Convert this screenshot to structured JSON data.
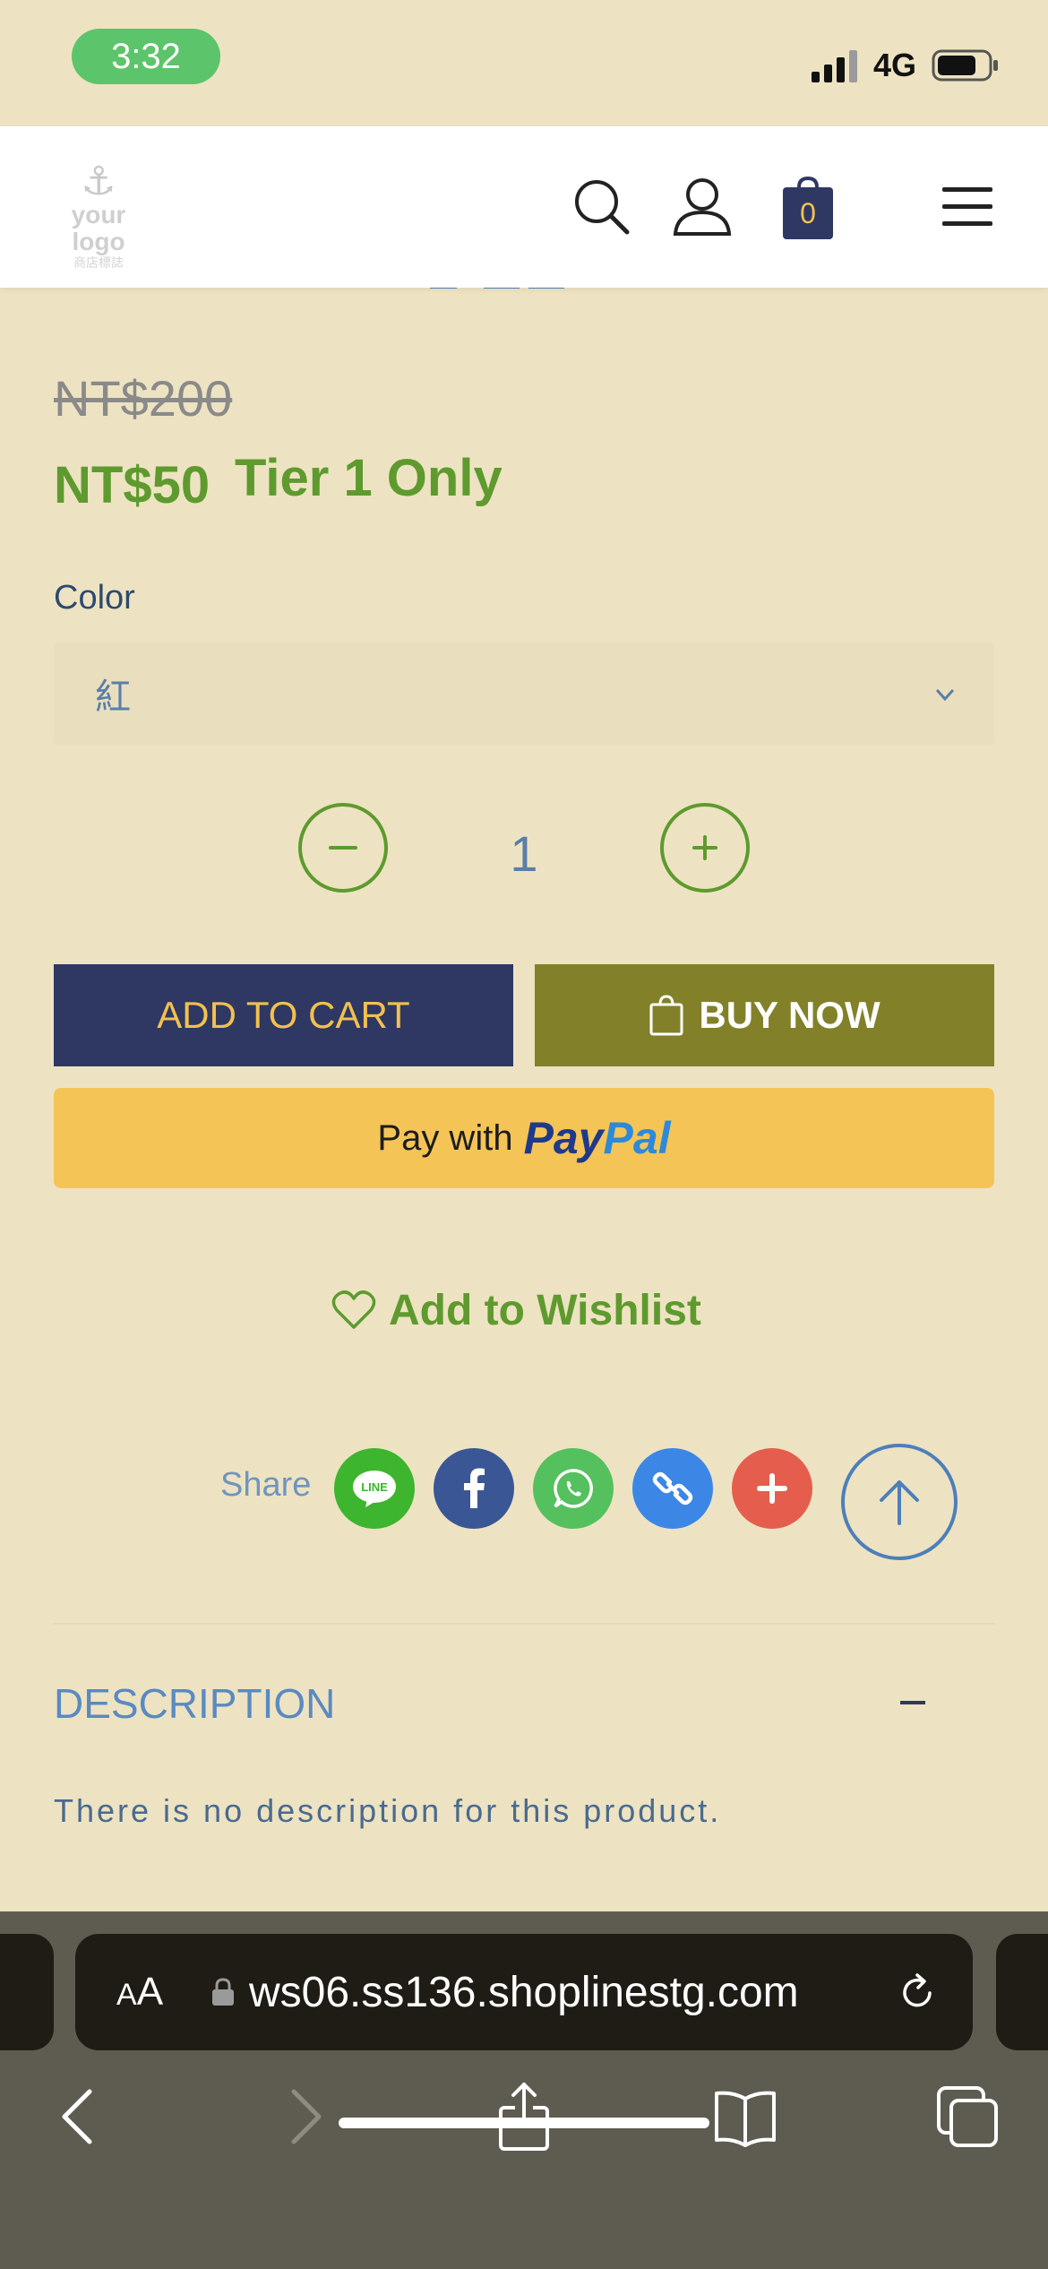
{
  "status_bar": {
    "time": "3:32",
    "network": "4G"
  },
  "header": {
    "logo": {
      "line1": "your logo",
      "line2": "商店標誌"
    },
    "cart_count": "0"
  },
  "product": {
    "original_price": "NT$200",
    "sale_price": "NT$50",
    "tier_label": "Tier 1 Only",
    "color_label": "Color",
    "color_value": "紅",
    "quantity": "1",
    "add_to_cart": "ADD TO CART",
    "buy_now": "BUY NOW",
    "paypal_prefix": "Pay with",
    "paypal_brand_pay": "Pay",
    "paypal_brand_pal": "Pal",
    "wishlist": "Add to Wishlist",
    "share_label": "Share",
    "share_line": "LINE"
  },
  "description": {
    "title": "DESCRIPTION",
    "toggle": "–",
    "text": "There is no description for this product."
  },
  "browser": {
    "aa_small": "A",
    "aa_big": "A",
    "url": "ws06.ss136.shoplinestg.com"
  },
  "colors": {
    "background": "#EDE3C2",
    "accent_green": "#5E9A2E",
    "navy": "#2F3863",
    "olive": "#82812A",
    "paypal_yellow": "#F5C457"
  }
}
